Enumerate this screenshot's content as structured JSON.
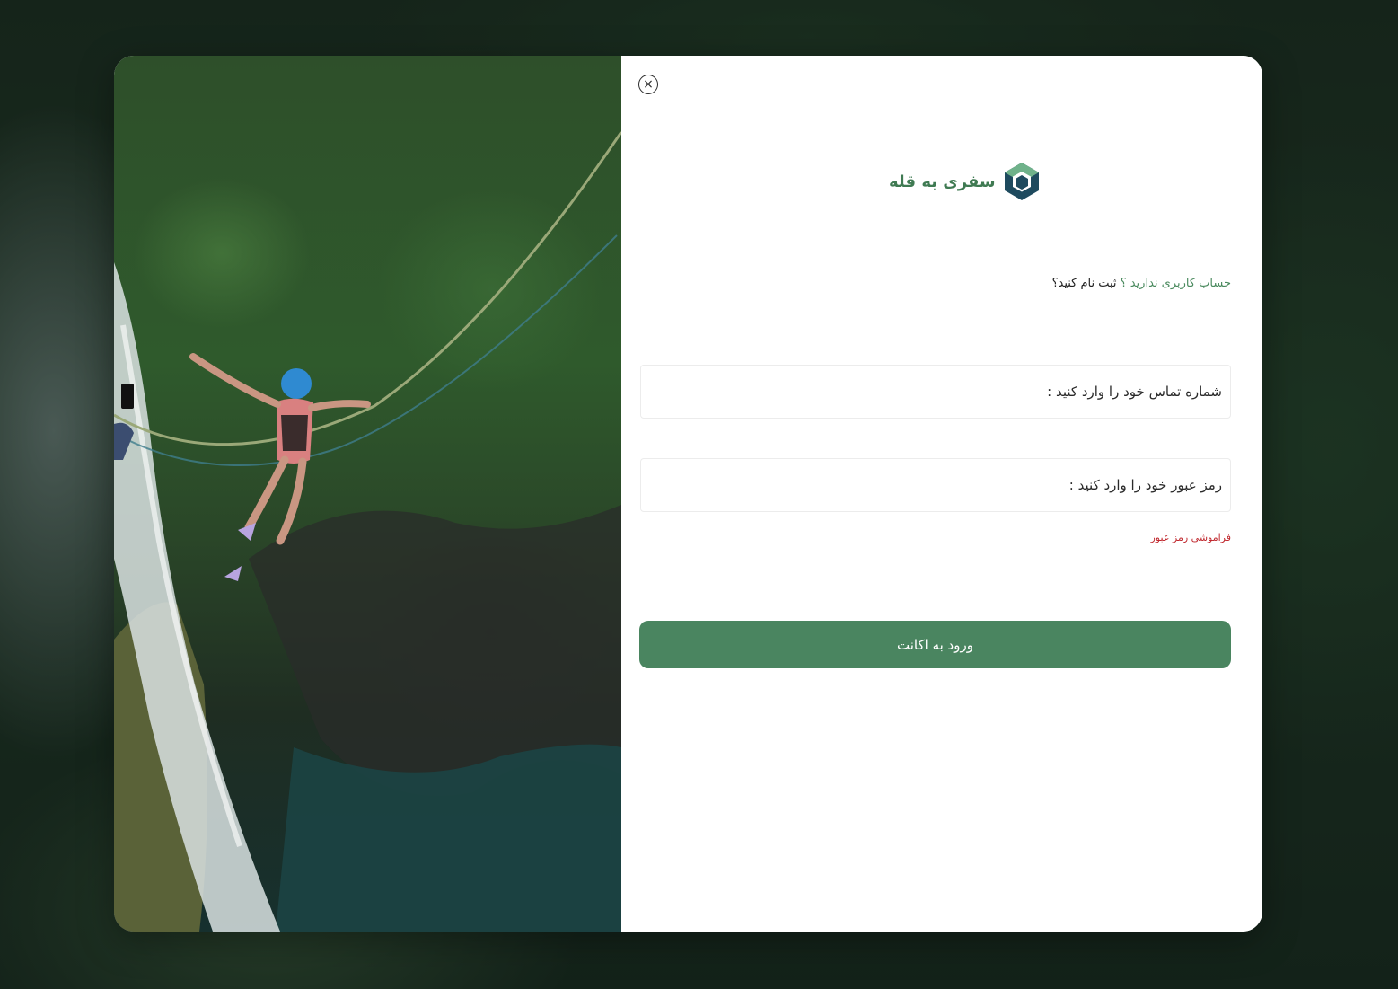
{
  "brand": {
    "name": "سفری به قله",
    "accent_color": "#3f7a52",
    "logo_icon": "hexagon-logo-icon"
  },
  "close": {
    "icon": "close-circle-icon",
    "symbol": "×"
  },
  "signup": {
    "question": "حساب کاربری ندارید ؟",
    "link_text": "ثبت نام کنید؟"
  },
  "form": {
    "phone_placeholder": "شماره تماس خود را وارد کنید :",
    "phone_value": "",
    "password_placeholder": "رمز عبور خود را وارد کنید :",
    "password_value": "",
    "forgot_password": "فراموشی رمز عبور",
    "forgot_color": "#c0272d",
    "submit_label": "ورود به اکانت",
    "submit_color": "#4a8560"
  },
  "image": {
    "subject": "zipline-over-waterfall-photo"
  }
}
